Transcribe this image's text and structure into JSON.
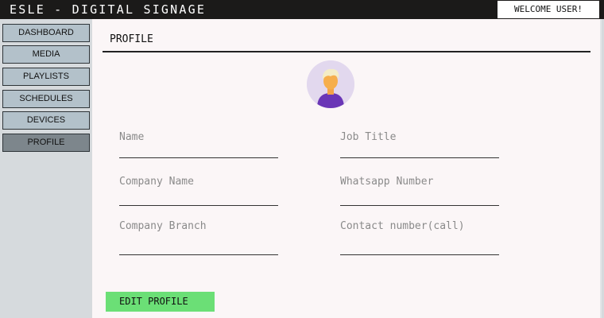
{
  "header": {
    "app_title": "ESLE - DIGITAL SIGNAGE",
    "welcome": "WELCOME USER!"
  },
  "sidebar": {
    "items": [
      {
        "label": "DASHBOARD",
        "active": false
      },
      {
        "label": "MEDIA",
        "active": false
      },
      {
        "label": "PLAYLISTS",
        "active": false
      },
      {
        "label": "SCHEDULES",
        "active": false
      },
      {
        "label": "DEVICES",
        "active": false
      },
      {
        "label": "PROFILE",
        "active": true
      }
    ]
  },
  "main": {
    "title": "PROFILE",
    "avatar_icon": "user-avatar-icon",
    "fields": {
      "name": {
        "label": "Name",
        "value": ""
      },
      "job_title": {
        "label": "Job Title",
        "value": ""
      },
      "company_name": {
        "label": "Company Name",
        "value": ""
      },
      "whatsapp_number": {
        "label": "Whatsapp Number",
        "value": ""
      },
      "company_branch": {
        "label": "Company Branch",
        "value": ""
      },
      "contact_number": {
        "label": "Contact number(call)",
        "value": ""
      }
    },
    "edit_button": "EDIT PROFILE"
  },
  "colors": {
    "header_bg": "#1b1a19",
    "sidebar_bg": "#d6dadd",
    "nav_item_bg": "#b3c1ca",
    "nav_item_active_bg": "#7d868c",
    "content_bg": "#fbf6f7",
    "edit_button_bg": "#6bdf76",
    "avatar_bg": "#e2d8ee"
  }
}
